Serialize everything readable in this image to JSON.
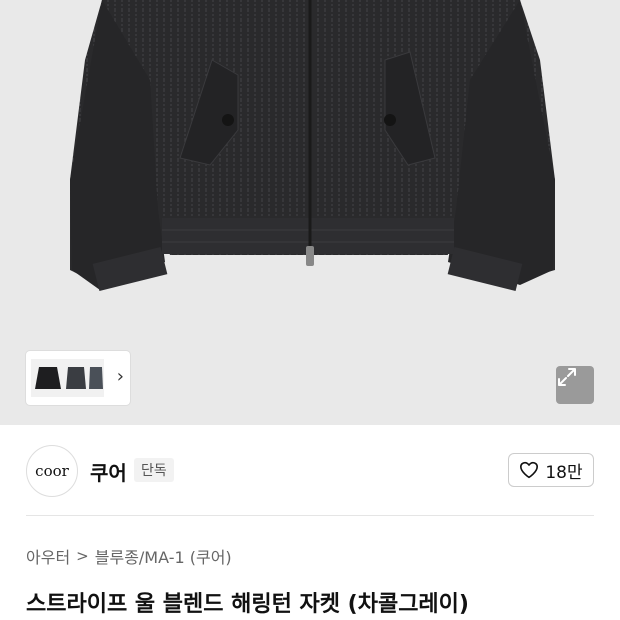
{
  "gallery": {
    "thumbnail_count": 3,
    "icons": {
      "next": "chevron-right-icon",
      "expand": "expand-icon"
    }
  },
  "brand": {
    "logo_text": "coor",
    "name": "쿠어",
    "badge": "단독"
  },
  "like": {
    "icon": "heart-outline-icon",
    "count": "18만"
  },
  "breadcrumb": {
    "category": "아우터",
    "separator": ">",
    "subcategory": "블루종/MA-1 (쿠어)"
  },
  "product": {
    "title": "스트라이프 울 블렌드 해링턴 자켓 (차콜그레이)"
  },
  "colors": {
    "hero_background": "#e9e9e9",
    "jacket": "#2a2a2c",
    "expand_button": "#9a9a9a"
  }
}
